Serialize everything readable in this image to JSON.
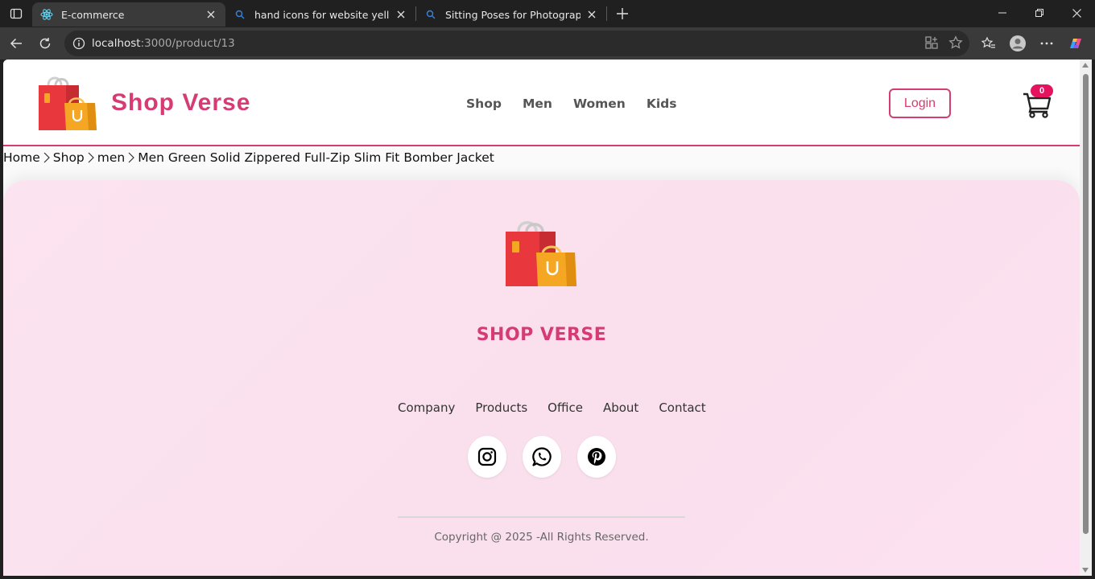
{
  "browser": {
    "tabs": [
      {
        "title": "E-commerce",
        "icon": "react-icon",
        "active": true
      },
      {
        "title": "hand icons for website yellow colo",
        "icon": "search-icon",
        "active": false
      },
      {
        "title": "Sitting Poses for Photography - Se",
        "icon": "search-icon",
        "active": false
      }
    ],
    "url_host": "localhost",
    "url_path": ":3000/product/13"
  },
  "navbar": {
    "brand": "Shop Verse",
    "menu": [
      "Shop",
      "Men",
      "Women",
      "Kids"
    ],
    "login_label": "Login",
    "cart_count": "0",
    "accent_color": "#d63b73"
  },
  "breadcrumb": {
    "home": "Home",
    "shop": "Shop",
    "category": "men",
    "product": "Men Green Solid Zippered Full-Zip Slim Fit Bomber Jacket"
  },
  "footer": {
    "title": "SHOP VERSE",
    "links": [
      "Company",
      "Products",
      "Office",
      "About",
      "Contact"
    ],
    "socials": [
      "instagram-icon",
      "whatsapp-icon",
      "pinterest-icon"
    ],
    "copyright": "Copyright @ 2025 -All Rights Reserved."
  }
}
